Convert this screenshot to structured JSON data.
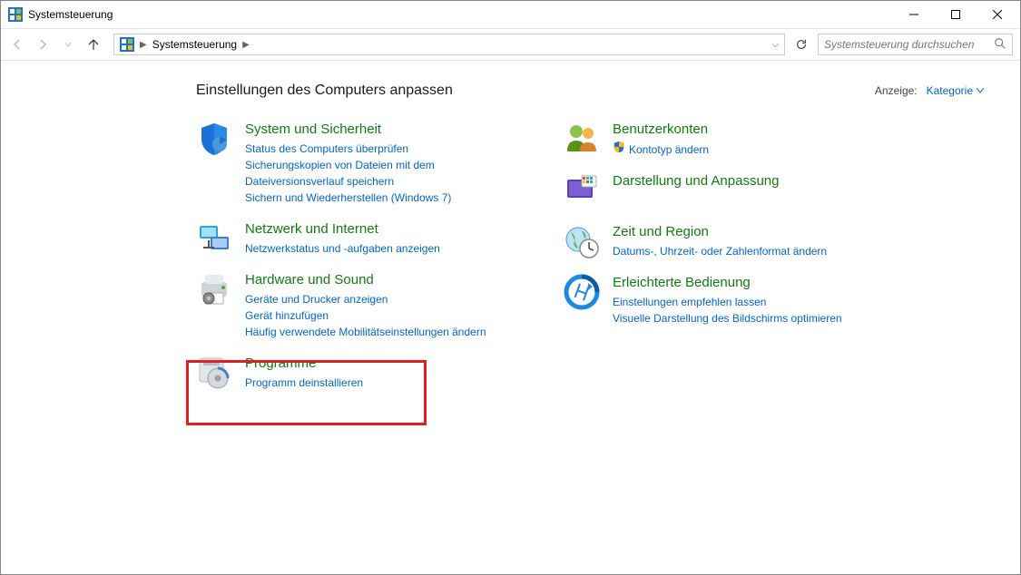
{
  "window": {
    "title": "Systemsteuerung"
  },
  "breadcrumb": {
    "root": "Systemsteuerung"
  },
  "search": {
    "placeholder": "Systemsteuerung durchsuchen"
  },
  "main": {
    "heading": "Einstellungen des Computers anpassen",
    "view_label": "Anzeige:",
    "view_value": "Kategorie"
  },
  "categories": {
    "left": [
      {
        "title": "System und Sicherheit",
        "links": [
          "Status des Computers überprüfen",
          "Sicherungskopien von Dateien mit dem Dateiversionsverlauf speichern",
          "Sichern und Wiederherstellen (Windows 7)"
        ]
      },
      {
        "title": "Netzwerk und Internet",
        "links": [
          "Netzwerkstatus und -aufgaben anzeigen"
        ]
      },
      {
        "title": "Hardware und Sound",
        "links": [
          "Geräte und Drucker anzeigen",
          "Gerät hinzufügen",
          "Häufig verwendete Mobilitätseinstellungen ändern"
        ]
      },
      {
        "title": "Programme",
        "links": [
          "Programm deinstallieren"
        ]
      }
    ],
    "right": [
      {
        "title": "Benutzerkonten",
        "links": [
          "Kontotyp ändern"
        ],
        "shield": true
      },
      {
        "title": "Darstellung und Anpassung",
        "links": []
      },
      {
        "title": "Zeit und Region",
        "links": [
          "Datums-, Uhrzeit- oder Zahlenformat ändern"
        ]
      },
      {
        "title": "Erleichterte Bedienung",
        "links": [
          "Einstellungen empfehlen lassen",
          "Visuelle Darstellung des Bildschirms optimieren"
        ]
      }
    ]
  }
}
